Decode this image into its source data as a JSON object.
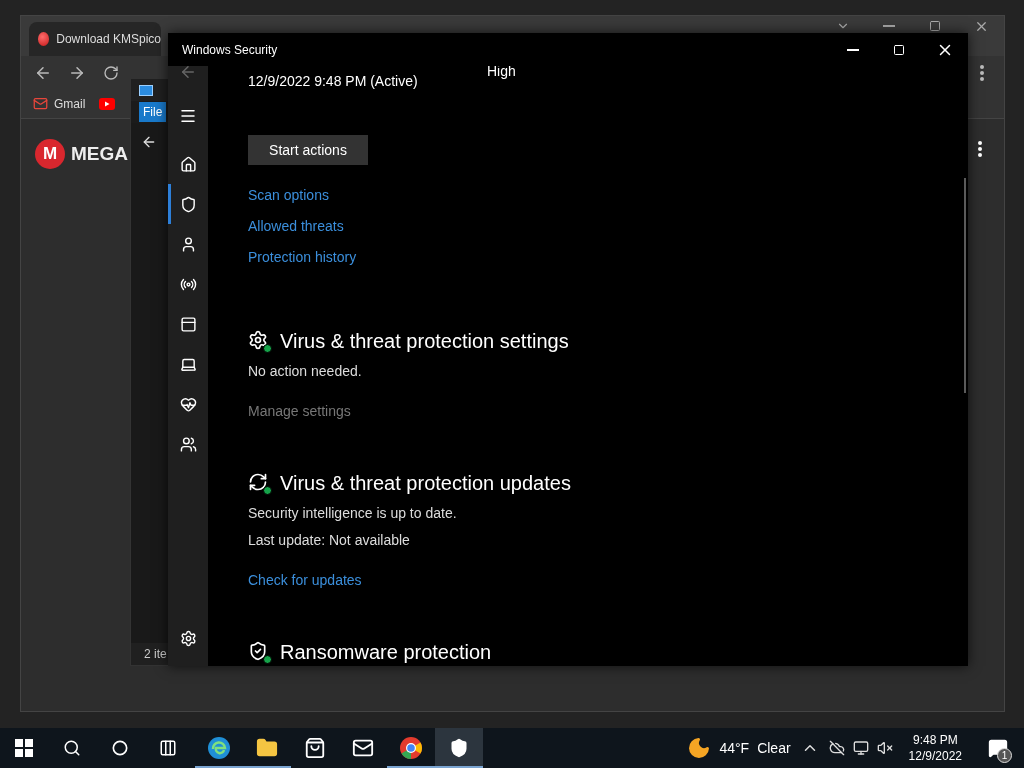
{
  "browser": {
    "tabs": [
      {
        "title": "Download KMSpico",
        "selected": true
      }
    ],
    "bookmarks": [
      {
        "kind": "gmail",
        "label": "Gmail"
      },
      {
        "kind": "youtube"
      }
    ],
    "page": {
      "logo_mark": "M",
      "logo_text": "MEGA"
    }
  },
  "explorer": {
    "ribbon_tabs": [
      {
        "label": "File",
        "selected": true
      }
    ],
    "status_bar": "2 ite"
  },
  "security_window": {
    "title": "Windows Security",
    "nav": [
      {
        "kind": "home",
        "selected": false
      },
      {
        "kind": "shield",
        "selected": true
      },
      {
        "kind": "person",
        "selected": false
      },
      {
        "kind": "wireless",
        "selected": false
      },
      {
        "kind": "window",
        "selected": false
      },
      {
        "kind": "laptop",
        "selected": false
      },
      {
        "kind": "heart",
        "selected": false
      },
      {
        "kind": "family",
        "selected": false
      }
    ],
    "threat": {
      "date": "12/9/2022 9:48 PM (Active)",
      "severity": "High"
    },
    "start_button": "Start actions",
    "links": [
      "Scan options",
      "Allowed threats",
      "Protection history"
    ],
    "sections": [
      {
        "kind": "settings",
        "heading": "Virus & threat protection settings",
        "lines": [
          "No action needed."
        ],
        "link": {
          "label": "Manage settings",
          "disabled": true
        }
      },
      {
        "kind": "updates",
        "heading": "Virus & threat protection updates",
        "lines": [
          "Security intelligence is up to date.",
          "Last update: Not available"
        ],
        "link": {
          "label": "Check for updates",
          "disabled": false
        }
      },
      {
        "kind": "ransomware",
        "heading": "Ransomware protection"
      }
    ]
  },
  "taskbar": {
    "apps": [
      {
        "kind": "start",
        "running": false,
        "selected": false
      },
      {
        "kind": "search",
        "running": false,
        "selected": false
      },
      {
        "kind": "cortana",
        "running": false,
        "selected": false
      },
      {
        "kind": "taskview",
        "running": false,
        "selected": false
      },
      {
        "kind": "edge",
        "running": true,
        "selected": false
      },
      {
        "kind": "files",
        "running": true,
        "selected": false
      },
      {
        "kind": "store",
        "running": false,
        "selected": false
      },
      {
        "kind": "mail",
        "running": false,
        "selected": false
      },
      {
        "kind": "chrome",
        "running": true,
        "selected": false
      },
      {
        "kind": "security",
        "running": true,
        "selected": true
      }
    ],
    "weather": {
      "temperature": "44°F",
      "condition": "Clear"
    },
    "clock": {
      "time": "9:48 PM",
      "date": "12/9/2022"
    },
    "notifications": {
      "count": "1"
    }
  }
}
